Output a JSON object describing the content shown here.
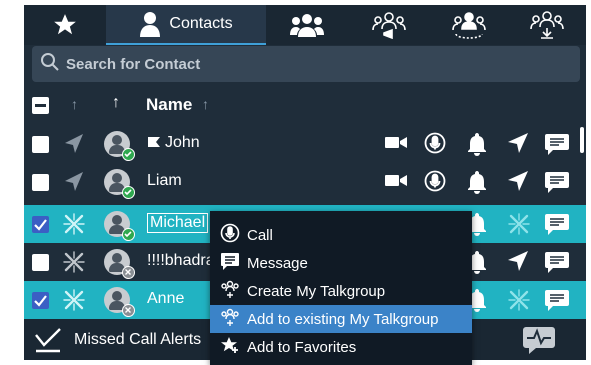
{
  "tabs": [
    {
      "label": "",
      "icon": "star-icon"
    },
    {
      "label": "Contacts",
      "icon": "person-icon",
      "active": true
    },
    {
      "label": "",
      "icon": "group-icon"
    },
    {
      "label": "",
      "icon": "talkgroup-broadcast-icon"
    },
    {
      "label": "",
      "icon": "talkgroup-people-icon"
    },
    {
      "label": "",
      "icon": "talkgroup-download-icon"
    }
  ],
  "search": {
    "placeholder": "Search for Contact"
  },
  "list_header": {
    "name_label": "Name"
  },
  "contacts": [
    {
      "name": "John",
      "status": "online",
      "checked": false,
      "selected": false,
      "flag": true
    },
    {
      "name": "Liam",
      "status": "online",
      "checked": false,
      "selected": false,
      "flag": false
    },
    {
      "name": "Michael",
      "status": "online",
      "checked": true,
      "selected": true,
      "flag": false
    },
    {
      "name": "!!!!bhadra",
      "status": "offline",
      "checked": false,
      "selected": false,
      "flag": false
    },
    {
      "name": "Anne",
      "status": "offline",
      "checked": true,
      "selected": true,
      "flag": false
    }
  ],
  "context_menu": {
    "items": [
      {
        "label": "Call",
        "icon": "mic-circle-icon",
        "highlighted": false
      },
      {
        "label": "Message",
        "icon": "message-icon",
        "highlighted": false
      },
      {
        "label": "Create My Talkgroup",
        "icon": "create-talkgroup-icon",
        "highlighted": false
      },
      {
        "label": "Add to existing My Talkgroup",
        "icon": "add-talkgroup-icon",
        "highlighted": true
      },
      {
        "label": "Add to Favorites",
        "icon": "star-plus-icon",
        "highlighted": false
      }
    ]
  },
  "bottom": {
    "missed_call_label": "Missed Call Alerts"
  },
  "colors": {
    "panel_bg": "#1f2d3a",
    "selected_row": "#21b3c2",
    "menu_bg": "#101a25",
    "menu_highlight": "#3b83c8",
    "online": "#2fa84f",
    "active_tab_underline": "#3fa0d8"
  }
}
